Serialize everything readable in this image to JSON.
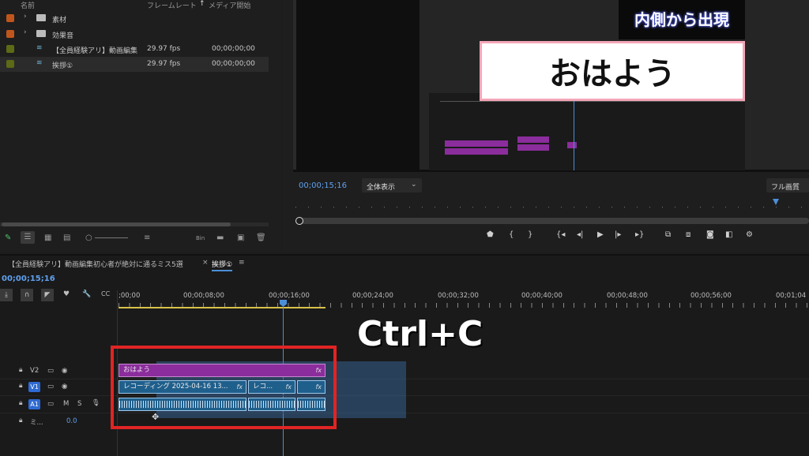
{
  "project": {
    "headers": {
      "name": "名前",
      "framerate": "フレームレート",
      "media_start": "メディア開始"
    },
    "items": [
      {
        "name": "素材",
        "type": "folder",
        "color": "#c0561c"
      },
      {
        "name": "効果音",
        "type": "folder",
        "color": "#c0561c"
      },
      {
        "name": "【全員経験アリ】動画編集",
        "type": "sequence",
        "color": "#5d6a16",
        "fps": "29.97 fps",
        "start": "00;00;00;00"
      },
      {
        "name": "挨拶①",
        "type": "sequence",
        "color": "#5d6a16",
        "fps": "29.97 fps",
        "start": "00;00;00;00"
      }
    ],
    "tools": [
      "pencil-icon",
      "list-view-icon",
      "icon-view-icon",
      "freeform-view-icon",
      "zoom-slider",
      "sort-icon",
      "bin-icon",
      "new-folder-icon",
      "new-item-icon",
      "trash-icon"
    ]
  },
  "monitor": {
    "overlay_card_text": "おはよう",
    "overlay_title_text": "内側から出現",
    "timecode": "00;00;15;16",
    "fit_label": "全体表示",
    "quality_label": "フル画質"
  },
  "timeline": {
    "tabs": [
      {
        "label": "【全員経験アリ】動画編集初心者が絶対に通るミス5選"
      },
      {
        "label": "挨拶①"
      }
    ],
    "timecode": "00;00;15;16",
    "ruler": [
      ";00;00",
      "00;00;08;00",
      "00;00;16;00",
      "00;00;24;00",
      "00;00;32;00",
      "00;00;40;00",
      "00;00;48;00",
      "00;00;56;00",
      "00;01;04"
    ],
    "tracks": {
      "v2": "V2",
      "v1": "V1",
      "a1": "A1",
      "mix": "ミ...",
      "mix_value": "0.0",
      "mute": "M",
      "solo": "S"
    },
    "clips": {
      "title_clip": "おはよう",
      "rec1": "レコーディング 2025-04-16 13...",
      "rec2": "レコ...",
      "fx": "fx"
    },
    "shortcut_overlay": "Ctrl+C",
    "colors": {
      "accent": "#2f6ad3",
      "highlight_box": "#e02424",
      "title_clip": "#8b2d9c",
      "video_clip": "#1f5f8c"
    }
  }
}
